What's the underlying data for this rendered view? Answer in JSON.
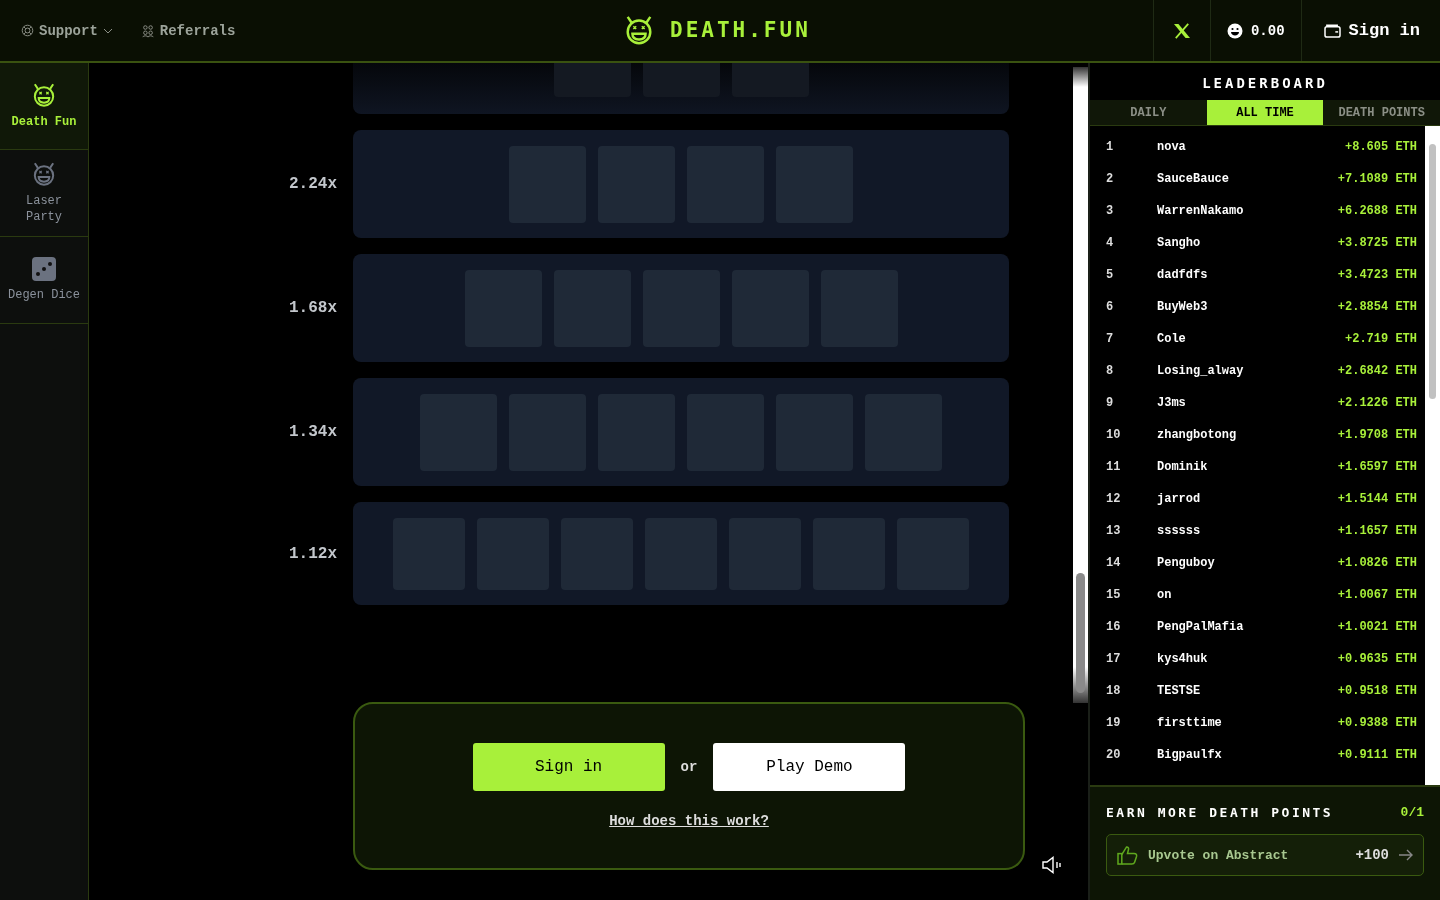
{
  "header": {
    "nav": [
      {
        "label": "Support",
        "kind": "support"
      },
      {
        "label": "Referrals",
        "kind": "referrals"
      }
    ],
    "logo": "DEATH.FUN",
    "balance": "0.00",
    "sign_in": "Sign in"
  },
  "sidebar": {
    "items": [
      {
        "label": "Death Fun",
        "kind": "devil",
        "selected": true
      },
      {
        "label": "Laser Party",
        "kind": "devil2",
        "selected": false
      },
      {
        "label": "Degen Dice",
        "kind": "dice",
        "selected": false
      }
    ]
  },
  "board": {
    "rows": [
      {
        "kind": "cut",
        "tiles": [
          {
            "kind": "hidden"
          },
          {
            "kind": "hidden"
          },
          {
            "kind": "hidden"
          }
        ]
      },
      {
        "kind": "full",
        "multiplier": "2.24x",
        "tiles": [
          {
            "kind": "hidden"
          },
          {
            "kind": "hidden"
          },
          {
            "kind": "hidden"
          },
          {
            "kind": "hidden"
          }
        ]
      },
      {
        "kind": "full",
        "multiplier": "1.68x",
        "tiles": [
          {
            "kind": "hidden"
          },
          {
            "kind": "hidden"
          },
          {
            "kind": "hidden"
          },
          {
            "kind": "hidden"
          },
          {
            "kind": "hidden"
          }
        ]
      },
      {
        "kind": "full",
        "multiplier": "1.34x",
        "tiles": [
          {
            "kind": "hidden"
          },
          {
            "kind": "hidden"
          },
          {
            "kind": "hidden"
          },
          {
            "kind": "hidden"
          },
          {
            "kind": "hidden"
          },
          {
            "kind": "hidden"
          }
        ]
      },
      {
        "kind": "small",
        "multiplier": "1.12x",
        "tiles": [
          {
            "kind": "hidden"
          },
          {
            "kind": "hidden"
          },
          {
            "kind": "hidden"
          },
          {
            "kind": "hidden"
          },
          {
            "kind": "hidden"
          },
          {
            "kind": "hidden"
          },
          {
            "kind": "hidden"
          }
        ]
      }
    ]
  },
  "cta": {
    "sign_in": "Sign in",
    "or": "or",
    "demo": "Play Demo",
    "link": "How does this work?"
  },
  "leaderboard": {
    "title": "LEADERBOARD",
    "tabs": [
      {
        "label": "DAILY",
        "selected": false
      },
      {
        "label": "ALL TIME",
        "selected": true
      },
      {
        "label": "DEATH POINTS",
        "selected": false
      }
    ],
    "rows": [
      {
        "rank": "1",
        "name": "nova",
        "amount": "+8.605 ETH"
      },
      {
        "rank": "2",
        "name": "SauceBauce",
        "amount": "+7.1089 ETH"
      },
      {
        "rank": "3",
        "name": "WarrenNakamo",
        "amount": "+6.2688 ETH"
      },
      {
        "rank": "4",
        "name": "Sangho",
        "amount": "+3.8725 ETH"
      },
      {
        "rank": "5",
        "name": "dadfdfs",
        "amount": "+3.4723 ETH"
      },
      {
        "rank": "6",
        "name": "BuyWeb3",
        "amount": "+2.8854 ETH"
      },
      {
        "rank": "7",
        "name": "Cole",
        "amount": "+2.719 ETH"
      },
      {
        "rank": "8",
        "name": "Losing_alway",
        "amount": "+2.6842 ETH"
      },
      {
        "rank": "9",
        "name": "J3ms",
        "amount": "+2.1226 ETH"
      },
      {
        "rank": "10",
        "name": "zhangbotong",
        "amount": "+1.9708 ETH"
      },
      {
        "rank": "11",
        "name": "Dominik",
        "amount": "+1.6597 ETH"
      },
      {
        "rank": "12",
        "name": "jarrod",
        "amount": "+1.5144 ETH"
      },
      {
        "rank": "13",
        "name": "ssssss",
        "amount": "+1.1657 ETH"
      },
      {
        "rank": "14",
        "name": "Penguboy",
        "amount": "+1.0826 ETH"
      },
      {
        "rank": "15",
        "name": "on",
        "amount": "+1.0067 ETH"
      },
      {
        "rank": "16",
        "name": "PengPalMafia",
        "amount": "+1.0021 ETH"
      },
      {
        "rank": "17",
        "name": "kys4huk",
        "amount": "+0.9635 ETH"
      },
      {
        "rank": "18",
        "name": "TESTSE",
        "amount": "+0.9518 ETH"
      },
      {
        "rank": "19",
        "name": "firsttime",
        "amount": "+0.9388 ETH"
      },
      {
        "rank": "20",
        "name": "Bigpaulfx",
        "amount": "+0.9111 ETH"
      }
    ]
  },
  "earn": {
    "title": "EARN MORE DEATH POINTS",
    "progress": "0/1",
    "tasks": [
      {
        "label": "Upvote on Abstract",
        "points": "+100"
      }
    ]
  }
}
